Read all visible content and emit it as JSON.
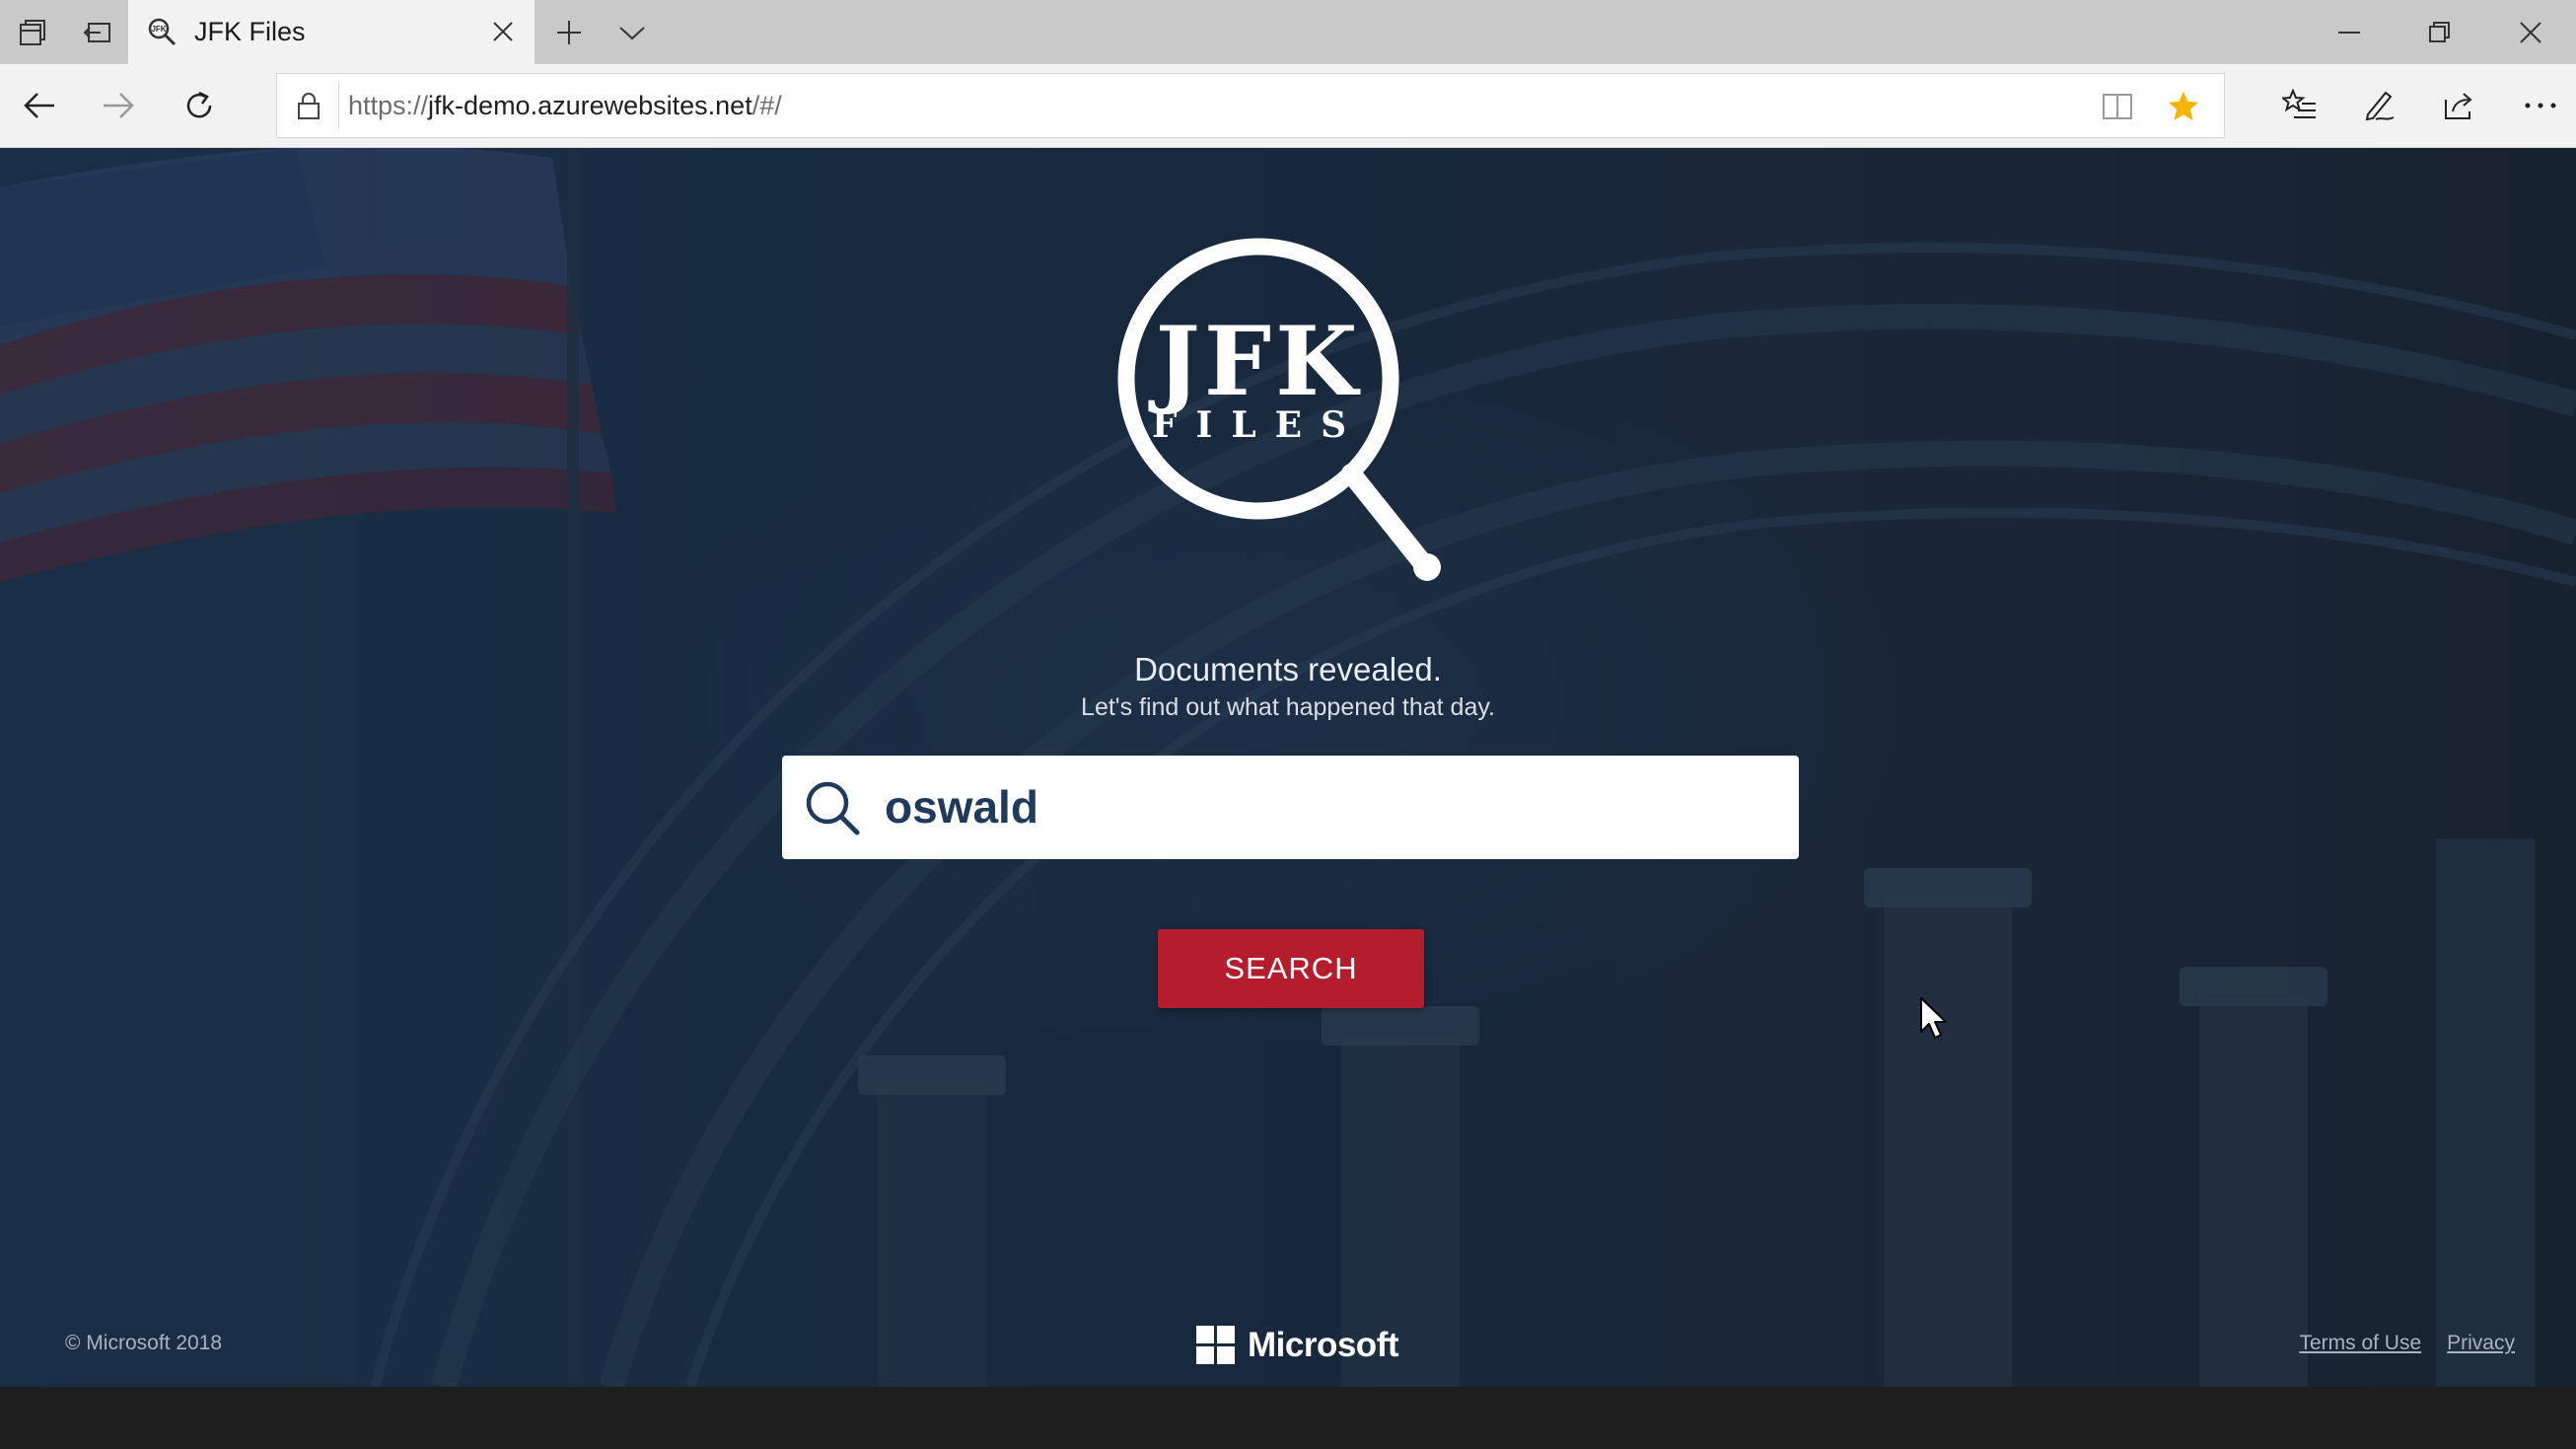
{
  "browser": {
    "tab": {
      "title": "JFK Files",
      "favicon": "search-icon"
    },
    "titlebar_icons": [
      "tabs-aside-icon",
      "tabs-back-icon",
      "new-tab-icon",
      "tab-list-chevron-icon",
      "minimize-icon",
      "restore-icon",
      "close-window-icon"
    ],
    "address": {
      "scheme": "https://",
      "host": "jfk-demo.azurewebsites.net",
      "path": "/#/"
    },
    "toolbar_icons": [
      "back-icon",
      "forward-icon",
      "refresh-icon",
      "lock-icon",
      "reading-view-icon",
      "favorite-star-icon",
      "favorites-hub-icon",
      "pen-icon",
      "share-icon",
      "more-icon"
    ],
    "favorite_color": "#f4b400"
  },
  "page": {
    "logo": {
      "line1": "JFK",
      "line2": "FILES"
    },
    "tagline": "Documents revealed.",
    "subtagline": "Let's find out what happened that day.",
    "search": {
      "value": "oswald",
      "button_label": "SEARCH"
    },
    "accent_color": "#b51c2c",
    "footer": {
      "copyright": "© Microsoft 2018",
      "brand": "Microsoft",
      "links": [
        "Terms of Use",
        "Privacy"
      ]
    }
  }
}
